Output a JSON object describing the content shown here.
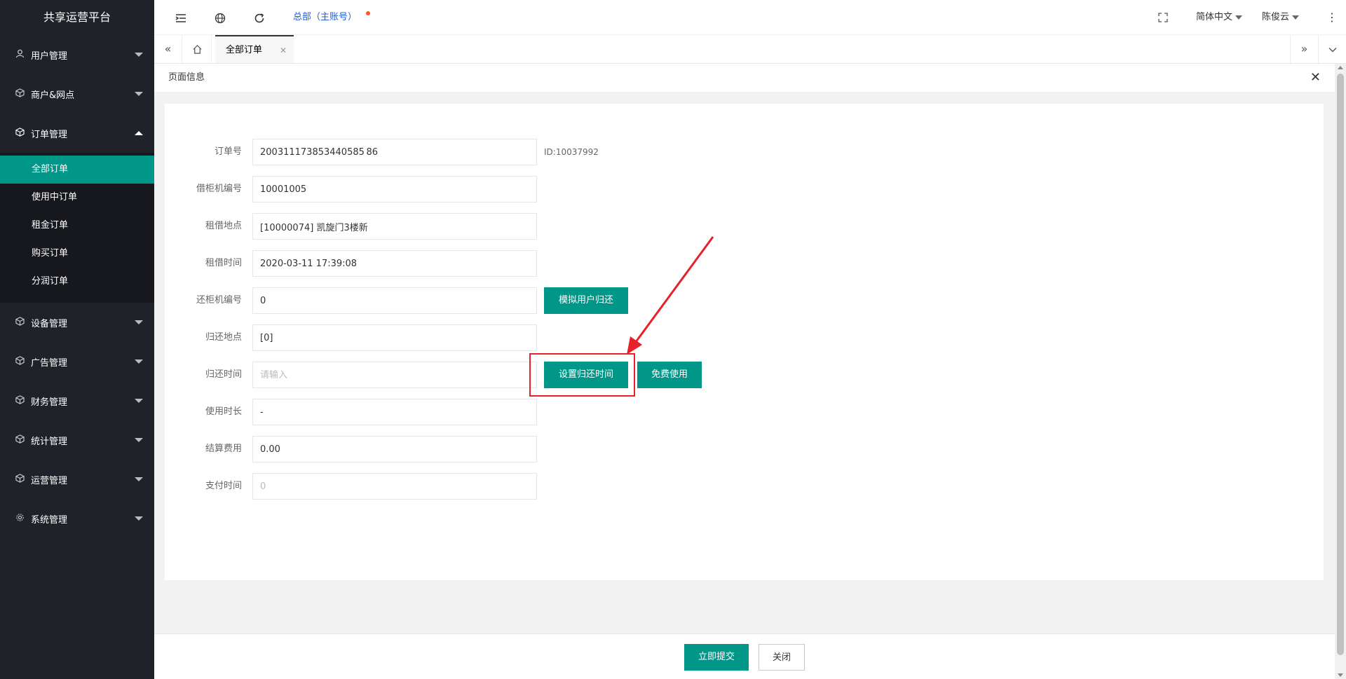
{
  "sidebar": {
    "logo": "共享运营平台",
    "groups": [
      {
        "label": "用户管理",
        "icon": "user-icon"
      },
      {
        "label": "商户&网点",
        "icon": "cube-icon"
      },
      {
        "label": "订单管理",
        "icon": "cube-icon",
        "expanded": true,
        "items": [
          "全部订单",
          "使用中订单",
          "租金订单",
          "购买订单",
          "分润订单"
        ],
        "active_item": "全部订单"
      },
      {
        "label": "设备管理",
        "icon": "cube-icon"
      },
      {
        "label": "广告管理",
        "icon": "cube-icon"
      },
      {
        "label": "财务管理",
        "icon": "cube-icon"
      },
      {
        "label": "统计管理",
        "icon": "cube-icon"
      },
      {
        "label": "运营管理",
        "icon": "cube-icon"
      },
      {
        "label": "系统管理",
        "icon": "gear-icon"
      }
    ]
  },
  "header": {
    "account": "总部（主账号）",
    "language": "简体中文",
    "user": "陈俊云"
  },
  "tabs": {
    "active_tab": "全部订单"
  },
  "page": {
    "title": "页面信息"
  },
  "form": {
    "order_no": {
      "label": "订单号",
      "value": "200311173853440585 86",
      "id_text": "ID:10037992"
    },
    "borrow_machine": {
      "label": "借柜机编号",
      "value": "10001005"
    },
    "borrow_location": {
      "label": "租借地点",
      "value": "[10000074] 凯旋门3楼新"
    },
    "borrow_time": {
      "label": "租借时间",
      "value": "2020-03-11 17:39:08"
    },
    "return_machine": {
      "label": "还柜机编号",
      "value": "0",
      "button": "模拟用户归还"
    },
    "return_location": {
      "label": "归还地点",
      "value": "[0]"
    },
    "return_time": {
      "label": "归还时间",
      "placeholder": "请输入",
      "button_set": "设置归还时间",
      "button_free": "免费使用"
    },
    "duration": {
      "label": "使用时长",
      "value": "-"
    },
    "fee": {
      "label": "结算费用",
      "value": "0.00"
    },
    "pay_time": {
      "label": "支付时间",
      "placeholder": "0"
    }
  },
  "footer": {
    "submit": "立即提交",
    "close": "关闭"
  },
  "colors": {
    "primary": "#009688",
    "sidebar_bg": "#20222a",
    "annotation": "#e8202a"
  }
}
